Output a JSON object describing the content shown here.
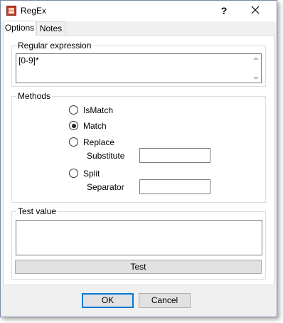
{
  "window": {
    "title": "RegEx",
    "help": "?"
  },
  "tabs": [
    {
      "label": "Options",
      "active": true
    },
    {
      "label": "Notes",
      "active": false
    }
  ],
  "regex_group": {
    "label": "Regular expression",
    "value": "[0-9]*"
  },
  "methods_group": {
    "label": "Methods",
    "options": [
      {
        "label": "IsMatch",
        "checked": false
      },
      {
        "label": "Match",
        "checked": true
      },
      {
        "label": "Replace",
        "checked": false
      },
      {
        "label": "Split",
        "checked": false
      }
    ],
    "substitute_label": "Substitute",
    "substitute_value": "",
    "separator_label": "Separator",
    "separator_value": ""
  },
  "test_group": {
    "label": "Test value",
    "value": "",
    "test_button": "Test"
  },
  "buttons": {
    "ok": "OK",
    "cancel": "Cancel"
  },
  "icons": {
    "app": "regex-app-icon",
    "close": "close-icon",
    "help": "help-icon"
  },
  "colors": {
    "accent": "#0078d7",
    "window_bg": "#f0f0f0",
    "app_icon": "#c23b22"
  }
}
